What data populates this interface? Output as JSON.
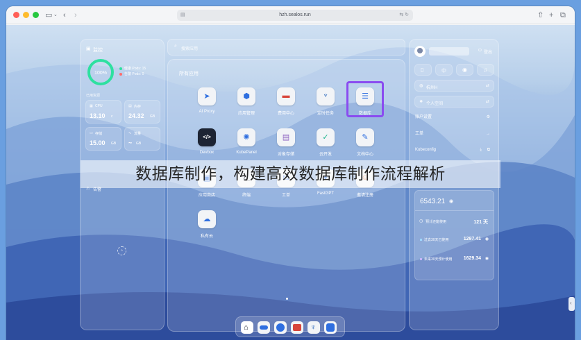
{
  "browser": {
    "url": "hzh.sealos.run"
  },
  "monitor": {
    "title": "监控",
    "gauge_value": "100%",
    "gauge_level": 1.0,
    "healthy_pods": "健康 Pods: 15",
    "alert_pods": "告警 Pods: 0",
    "resources_label": "已用资源",
    "cpu": {
      "label": "CPU",
      "value": "13.10",
      "unit": "c"
    },
    "memory": {
      "label": "内存",
      "value": "24.32",
      "unit": "GB"
    },
    "storage": {
      "label": "存储",
      "value": "15.00",
      "unit": "GB"
    },
    "traffic": {
      "label": "流量",
      "value": "~",
      "unit": "GB"
    },
    "alerts_label": "告警"
  },
  "search": {
    "placeholder": "搜索应用"
  },
  "apps_section": {
    "title": "所有应用",
    "apps": [
      {
        "label": "AI Proxy",
        "icon": "ai-proxy-icon"
      },
      {
        "label": "应用管理",
        "icon": "app-manage-icon"
      },
      {
        "label": "费用中心",
        "icon": "wallet-icon"
      },
      {
        "label": "定时任务",
        "icon": "cron-icon"
      },
      {
        "label": "数据库",
        "icon": "database-icon"
      },
      {
        "label": "Devbox",
        "icon": "devbox-icon"
      },
      {
        "label": "KubePanel",
        "icon": "kubepanel-icon"
      },
      {
        "label": "对象存储",
        "icon": "object-storage-icon"
      },
      {
        "label": "云开发",
        "icon": "cloud-dev-icon"
      },
      {
        "label": "文档中心",
        "icon": "docs-icon"
      },
      {
        "label": "应用商店",
        "icon": "app-store-icon"
      },
      {
        "label": "终端",
        "icon": "terminal-icon"
      },
      {
        "label": "工单",
        "icon": "ticket-icon"
      },
      {
        "label": "FastGPT",
        "icon": "fastgpt-icon"
      },
      {
        "label": "邀请注册",
        "icon": "invite-icon"
      },
      {
        "label": "私有云",
        "icon": "private-cloud-icon"
      }
    ]
  },
  "account": {
    "logout": "登出",
    "lang_button": "中",
    "region": "杭州H",
    "workspace": "个人空间",
    "settings": "账户设置",
    "ticket": "工单",
    "kubeconfig": "Kubeconfig",
    "balance": "6543.21",
    "days_label": "预计还能使用",
    "days_value": "121 天",
    "past_label": "过去30天已使用",
    "past_value": "1297.41",
    "future_label": "未来30天预计使用",
    "future_value": "1629.34"
  },
  "overlay_banner": "数据库制作，构建高效数据库制作流程解析",
  "colors": {
    "accent_purple": "#8a4cf0",
    "gauge_green": "#2ee0a0",
    "alert_red": "#ff6b6b"
  }
}
